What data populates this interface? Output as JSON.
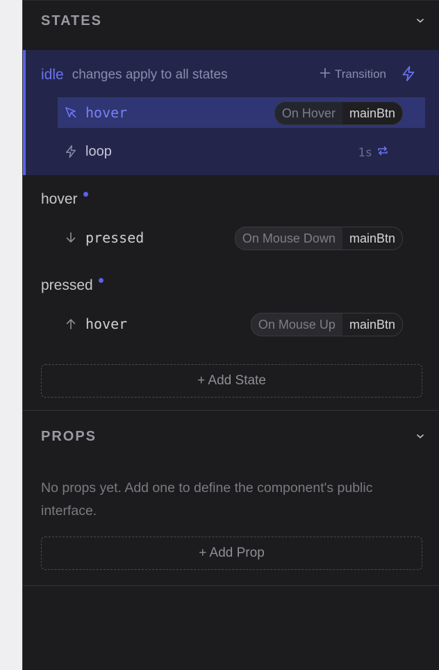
{
  "states_section": {
    "title": "STATES",
    "idle": {
      "name": "idle",
      "subtitle": "changes apply to all states",
      "transition_label": "Transition",
      "transitions": [
        {
          "target": "hover",
          "event": "On Hover",
          "element": "mainBtn",
          "icon": "cursor-icon"
        },
        {
          "target": "loop",
          "duration": "1s",
          "icon": "bolt-icon"
        }
      ]
    },
    "hover": {
      "name": "hover",
      "transitions": [
        {
          "target": "pressed",
          "event": "On Mouse Down",
          "element": "mainBtn",
          "icon": "arrow-down-icon"
        }
      ]
    },
    "pressed": {
      "name": "pressed",
      "transitions": [
        {
          "target": "hover",
          "event": "On Mouse Up",
          "element": "mainBtn",
          "icon": "arrow-up-icon"
        }
      ]
    },
    "add_label": "+ Add State"
  },
  "props_section": {
    "title": "PROPS",
    "empty_text": "No props yet. Add one to define the component's public interface.",
    "add_label": "+ Add Prop"
  },
  "colors": {
    "accent": "#5b62e8",
    "panel_bg": "#1c1c1e",
    "idle_bg": "#23264a",
    "active_row_bg": "#303673"
  }
}
